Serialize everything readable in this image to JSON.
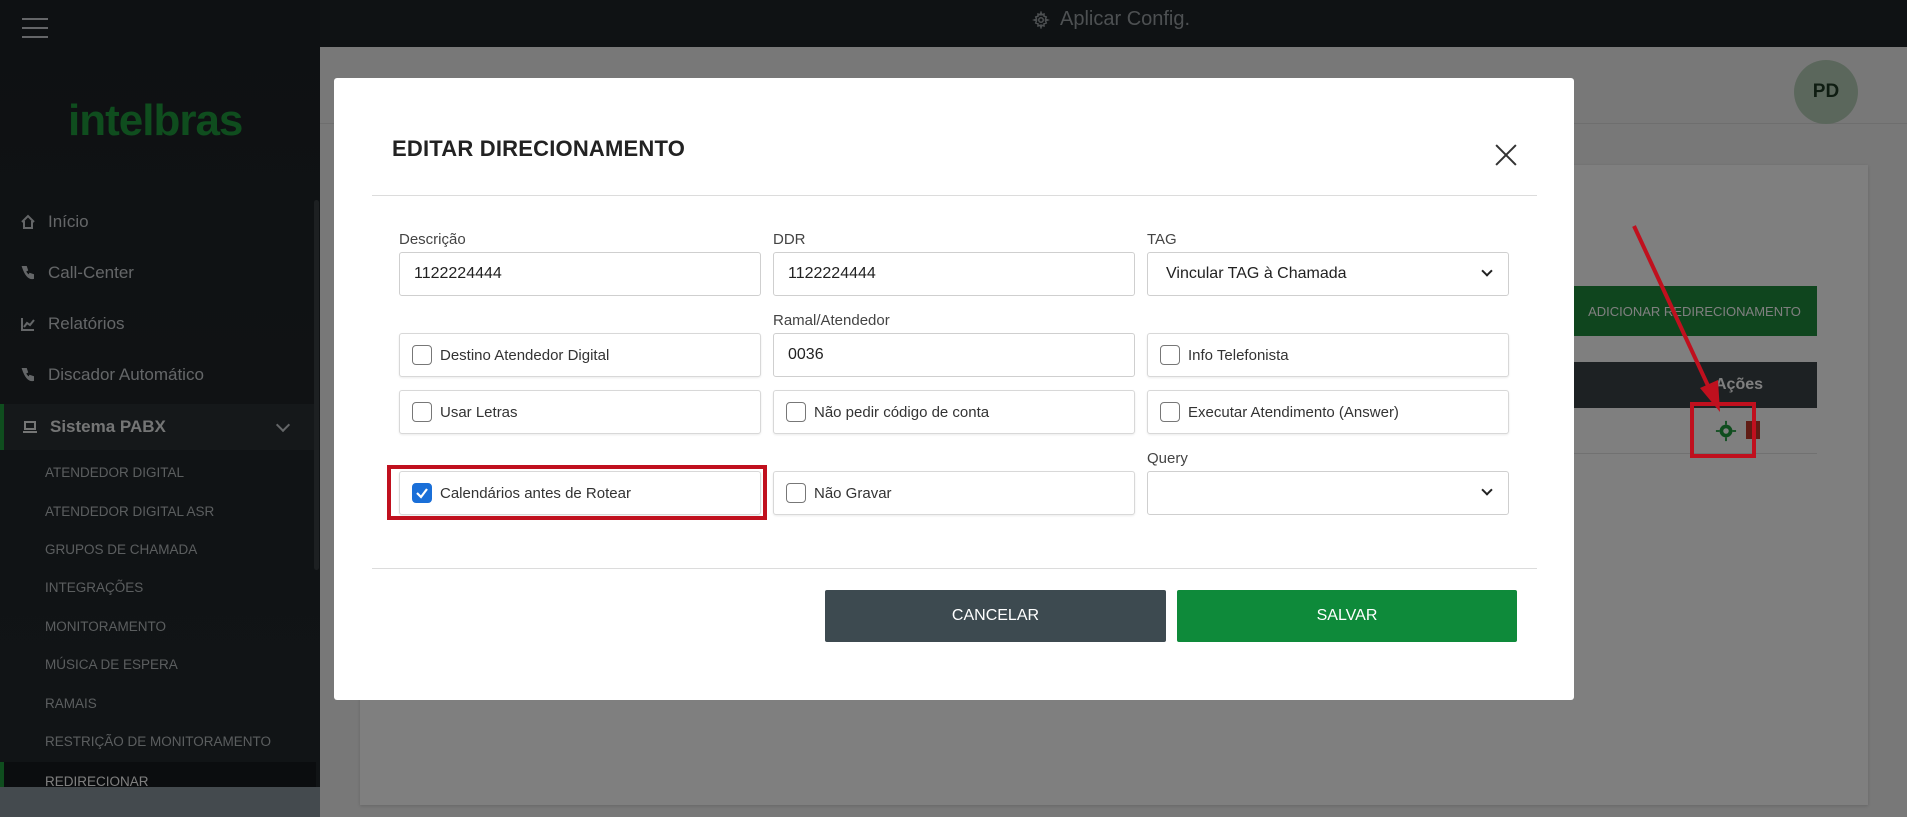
{
  "brand": {
    "logo_text": "intelbras",
    "accent": "#1e9a3c"
  },
  "topbar": {
    "apply_label": "Aplicar Config."
  },
  "sidebar": {
    "items": [
      {
        "label": "Início",
        "icon": "home-icon"
      },
      {
        "label": "Call-Center",
        "icon": "phone-icon"
      },
      {
        "label": "Relatórios",
        "icon": "chart-icon"
      },
      {
        "label": "Discador Automático",
        "icon": "phone-dial-icon"
      }
    ],
    "group": {
      "label": "Sistema PABX",
      "icon": "laptop-icon"
    },
    "sub_items": [
      "ATENDEDOR DIGITAL",
      "ATENDEDOR DIGITAL ASR",
      "GRUPOS DE CHAMADA",
      "INTEGRAÇÕES",
      "MONITORAMENTO",
      "MÚSICA DE ESPERA",
      "RAMAIS",
      "RESTRIÇÃO DE MONITORAMENTO",
      "REDIRECIONAR"
    ]
  },
  "page": {
    "avatar_initials": "PD",
    "add_button": "ADICIONAR REDIRECIONAMENTO",
    "table_header_actions": "Ações"
  },
  "modal": {
    "title": "EDITAR DIRECIONAMENTO",
    "fields": {
      "descricao": {
        "label": "Descrição",
        "value": "1122224444"
      },
      "ddr": {
        "label": "DDR",
        "value": "1122224444"
      },
      "tag": {
        "label": "TAG",
        "value": "Vincular TAG à Chamada"
      },
      "ramal": {
        "label": "Ramal/Atendedor",
        "value": "0036"
      },
      "query": {
        "label": "Query",
        "value": ""
      }
    },
    "checkboxes": {
      "destino": {
        "label": "Destino Atendedor Digital",
        "checked": false
      },
      "info_telefonista": {
        "label": "Info Telefonista",
        "checked": false
      },
      "usar_letras": {
        "label": "Usar Letras",
        "checked": false
      },
      "nao_pedir": {
        "label": "Não pedir código de conta",
        "checked": false
      },
      "executar": {
        "label": "Executar Atendimento (Answer)",
        "checked": false
      },
      "calendarios": {
        "label": "Calendários antes de Rotear",
        "checked": true
      },
      "nao_gravar": {
        "label": "Não Gravar",
        "checked": false
      }
    },
    "buttons": {
      "cancel": "CANCELAR",
      "save": "SALVAR"
    }
  }
}
